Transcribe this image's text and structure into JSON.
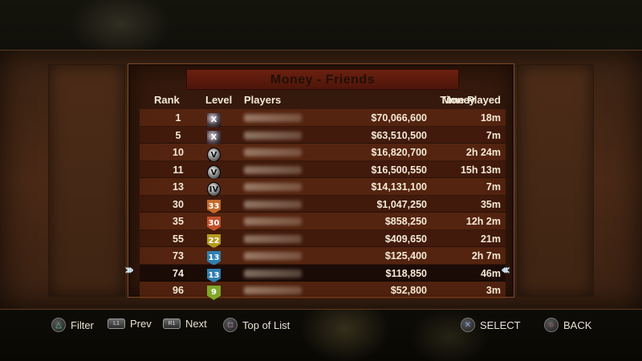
{
  "title": "Money - Friends",
  "columns": {
    "rank": "Rank",
    "level": "Level",
    "players": "Players",
    "money": "Money",
    "time": "Time Played"
  },
  "rows": [
    {
      "rank": "1",
      "level": "X",
      "level_style": "dark",
      "level_color": "#222222",
      "money": "$70,066,600",
      "time": "18m"
    },
    {
      "rank": "5",
      "level": "X",
      "level_style": "dark",
      "level_color": "#222222",
      "money": "$63,510,500",
      "time": "7m"
    },
    {
      "rank": "10",
      "level": "V",
      "level_style": "round",
      "level_color": "#cccccc",
      "money": "$16,820,700",
      "time": "2h 24m"
    },
    {
      "rank": "11",
      "level": "V",
      "level_style": "round",
      "level_color": "#cccccc",
      "money": "$16,500,550",
      "time": "15h 13m"
    },
    {
      "rank": "13",
      "level": "IV",
      "level_style": "round",
      "level_color": "#cccccc",
      "money": "$14,131,100",
      "time": "7m"
    },
    {
      "rank": "30",
      "level": "33",
      "level_style": "shield",
      "level_color": "#c46a2b",
      "money": "$1,047,250",
      "time": "35m"
    },
    {
      "rank": "35",
      "level": "30",
      "level_style": "shield",
      "level_color": "#c4512b",
      "money": "$858,250",
      "time": "12h 2m"
    },
    {
      "rank": "55",
      "level": "22",
      "level_style": "shield",
      "level_color": "#b59a1e",
      "money": "$409,650",
      "time": "21m"
    },
    {
      "rank": "73",
      "level": "13",
      "level_style": "shield",
      "level_color": "#2f7fb0",
      "money": "$125,400",
      "time": "2h 7m"
    },
    {
      "rank": "74",
      "level": "13",
      "level_style": "shield",
      "level_color": "#2f7fb0",
      "money": "$118,850",
      "time": "46m",
      "selected": true
    },
    {
      "rank": "96",
      "level": "9",
      "level_style": "shield",
      "level_color": "#7fa82a",
      "money": "$52,800",
      "time": "3m"
    }
  ],
  "controls": {
    "filter": "Filter",
    "prev_button": "L1",
    "prev": "Prev",
    "next_button": "R1",
    "next": "Next",
    "top": "Top of List",
    "select": "SELECT",
    "back": "BACK"
  }
}
